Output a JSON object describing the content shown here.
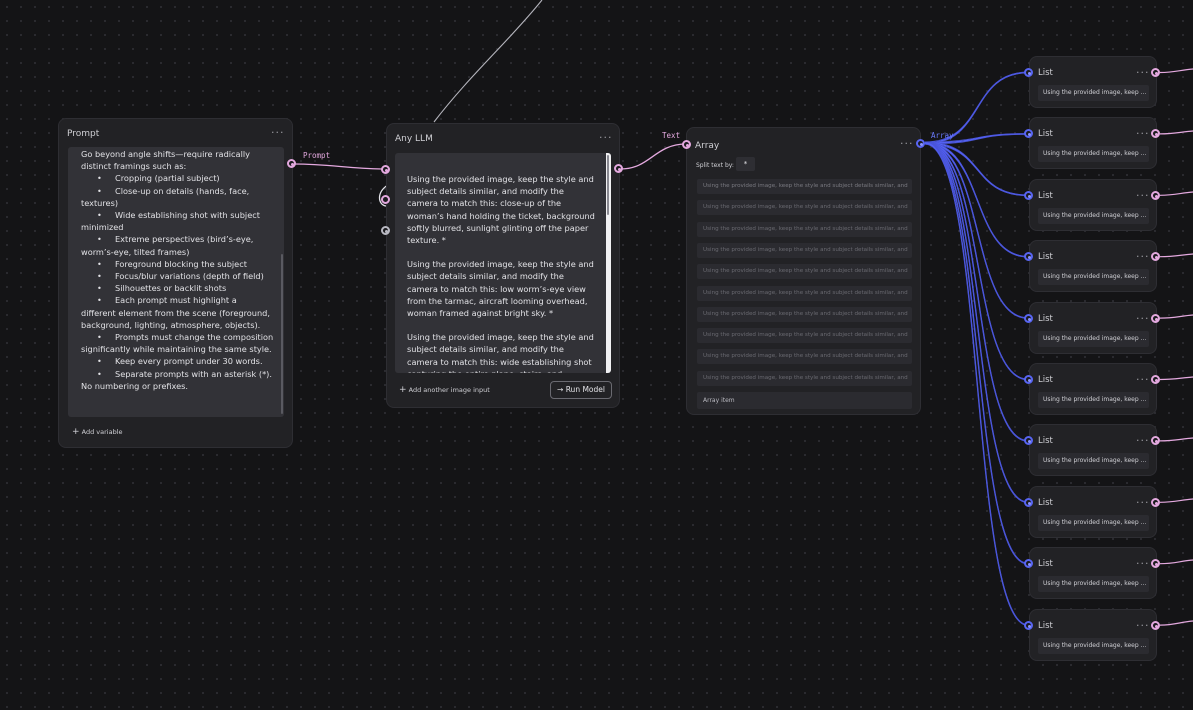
{
  "colors": {
    "canvas": "#141416",
    "node": "#222225",
    "pink": "#e4a9df",
    "blue": "#5865f2"
  },
  "prompt_node": {
    "title": "Prompt",
    "menu": "···",
    "add_variable": "Add variable",
    "add_icon": "+",
    "intro": "Go beyond angle shifts—require radically distinct framings such as:",
    "bullet": "•",
    "bullets": [
      "Cropping (partial subject)",
      "Close-up on details (hands, face, textures)",
      "Wide establishing shot with subject minimized",
      "Extreme perspectives (bird’s-eye, worm’s-eye, tilted frames)",
      "Foreground blocking the subject",
      "Focus/blur variations (depth of field)",
      "Silhouettes or backlit shots",
      "Each prompt must highlight a different element from the scene (foreground, background, lighting, atmosphere, objects).",
      "Prompts must change the composition significantly while maintaining the same style.",
      "Keep every prompt under 30 words.",
      "Separate prompts with an asterisk (*). No numbering or prefixes."
    ],
    "output_label": "Prompt"
  },
  "llm_node": {
    "title": "Any LLM",
    "menu": "···",
    "paragraphs": [
      "Using the provided image, keep the style and subject details similar, and modify the camera to match this: close-up of the woman’s hand holding the ticket, background softly blurred, sunlight glinting off the paper texture. *",
      "Using the provided image, keep the style and subject details similar, and modify the camera to match this: low worm’s-eye view from the tarmac, aircraft looming overhead, woman framed against bright sky. *",
      "Using the provided image, keep the style and subject details similar, and modify the camera to match this: wide establishing shot capturing the entire plane, stairs, and runway, woman"
    ],
    "add_image": "Add another image input",
    "add_icon": "+",
    "run_label": "Run Model",
    "run_icon": "→",
    "output_label": "Text"
  },
  "array_node": {
    "title": "Array",
    "menu": "···",
    "split_label": "Split text by:",
    "split_value": "*",
    "rows": [
      "Using the provided image, keep the style and subject details similar, and",
      "Using the provided image, keep the style and subject details similar, and",
      "Using the provided image, keep the style and subject details similar, and",
      "Using the provided image, keep the style and subject details similar, and",
      "Using the provided image, keep the style and subject details similar, and",
      "Using the provided image, keep the style and subject details similar, and",
      "Using the provided image, keep the style and subject details similar, and",
      "Using the provided image, keep the style and subject details similar, and",
      "Using the provided image, keep the style and subject details similar, and",
      "Using the provided image, keep the style and subject details similar, and"
    ],
    "footer": "Array item",
    "output_label": "Array"
  },
  "list_nodes": [
    {
      "title": "List",
      "menu": "···",
      "value": "Using the provided image, keep ..."
    },
    {
      "title": "List",
      "menu": "···",
      "value": "Using the provided image, keep ..."
    },
    {
      "title": "List",
      "menu": "···",
      "value": "Using the provided image, keep ..."
    },
    {
      "title": "List",
      "menu": "···",
      "value": "Using the provided image, keep ..."
    },
    {
      "title": "List",
      "menu": "···",
      "value": "Using the provided image, keep ..."
    },
    {
      "title": "List",
      "menu": "···",
      "value": "Using the provided image, keep ..."
    },
    {
      "title": "List",
      "menu": "···",
      "value": "Using the provided image, keep ..."
    },
    {
      "title": "List",
      "menu": "···",
      "value": "Using the provided image, keep ..."
    },
    {
      "title": "List",
      "menu": "···",
      "value": "Using the provided image, keep ..."
    },
    {
      "title": "List",
      "menu": "···",
      "value": "Using the provided image, keep ..."
    }
  ]
}
